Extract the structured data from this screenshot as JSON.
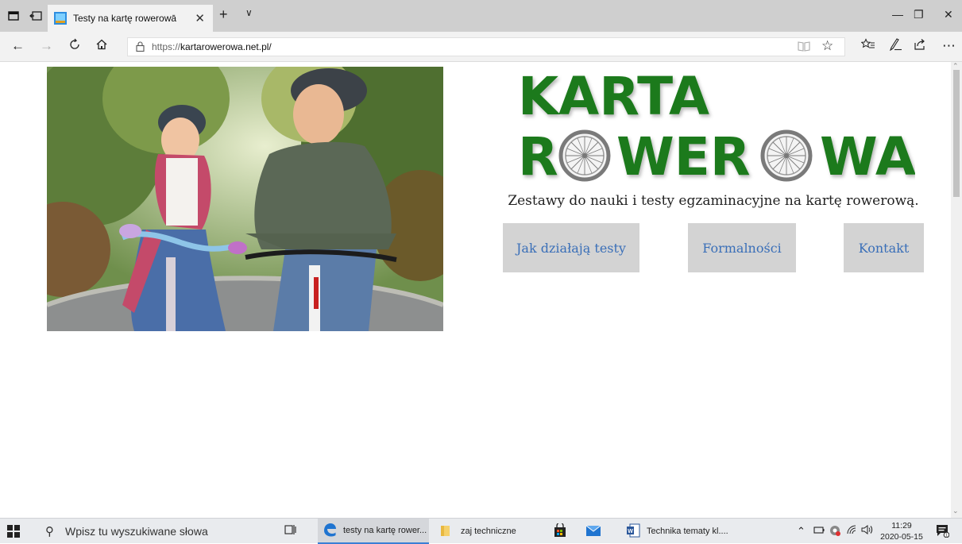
{
  "browser": {
    "tab_title": "Testy na kartę rowerowā",
    "tab_close": "✕",
    "new_tab": "+",
    "tab_menu": "∨",
    "url_proto": "https://",
    "url_host": "kartarowerowa.net.pl/",
    "window_min": "—",
    "window_restore": "❐",
    "window_close": "✕"
  },
  "page": {
    "logo_line1": "KARTA",
    "logo_line2_a": "R",
    "logo_line2_b": "WER",
    "logo_line2_c": "WA",
    "tagline": "Zestawy do nauki i testy egzaminacyjne na kartę rowerową.",
    "nav": [
      {
        "label": "Jak działają testy"
      },
      {
        "label": "Formalności"
      },
      {
        "label": "Kontakt"
      }
    ],
    "logo_color": "#1f7a1f"
  },
  "taskbar": {
    "search_placeholder": "Wpisz tu wyszukiwane słowa",
    "apps": [
      {
        "label": "testy na kartę rower..."
      },
      {
        "label": "zaj techniczne"
      },
      {
        "label": "Technika tematy kl...."
      }
    ],
    "time": "11:29",
    "date": "2020-05-15"
  }
}
